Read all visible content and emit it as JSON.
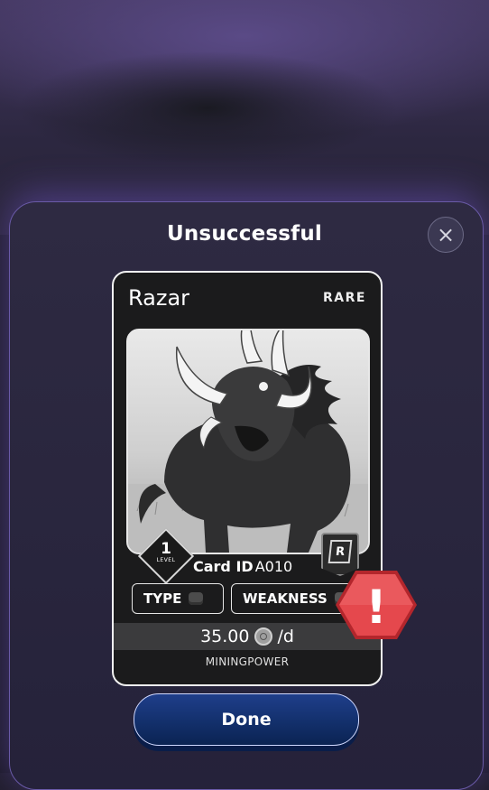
{
  "dialog": {
    "title": "Unsuccessful",
    "close_icon": "close-icon"
  },
  "card": {
    "name": "Razar",
    "rarity": "RARE",
    "level": "1",
    "level_label": "LEVEL",
    "rarity_badge": "R",
    "card_id_label": "Card ID",
    "card_id": "A010",
    "type_label": "TYPE",
    "type_icon": "fist-icon",
    "weakness_label": "WEAKNESS",
    "weakness_icon": "fist-icon",
    "rate_value": "35.00",
    "rate_unit": "/d",
    "coin_icon": "coin-icon",
    "mining_label": "MININGPOWER"
  },
  "alert": {
    "icon": "warning-octagon-icon",
    "glyph": "!",
    "color": "#e5484d"
  },
  "actions": {
    "done_label": "Done"
  },
  "colors": {
    "accent_border": "#6a5aa8",
    "button_blue": "#13306c"
  }
}
